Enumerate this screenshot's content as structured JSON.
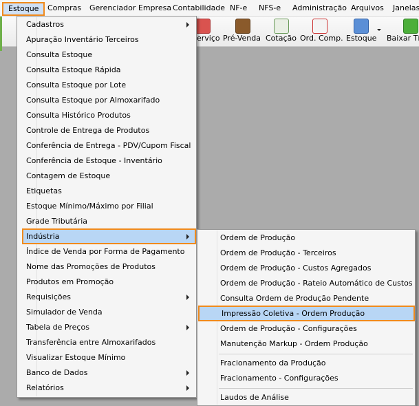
{
  "menubar": {
    "items": [
      "Estoque",
      "Compras",
      "Gerenciador Empresa",
      "Contabilidade",
      "NF-e",
      "NFS-e",
      "Administração",
      "Arquivos",
      "Janelas"
    ]
  },
  "toolbar": {
    "buttons": [
      {
        "label": "erviço",
        "icon": "service-icon"
      },
      {
        "label": "Pré-Venda",
        "icon": "pre-sale-icon"
      },
      {
        "label": "Cotação",
        "icon": "quotation-icon"
      },
      {
        "label": "Ord. Comp.",
        "icon": "purchase-order-icon"
      },
      {
        "label": "Estoque",
        "icon": "stock-icon"
      },
      {
        "label": "Baixar Títu",
        "icon": "check-icon"
      }
    ]
  },
  "estoque_menu": {
    "items": [
      {
        "label": "Cadastros",
        "submenu": true
      },
      {
        "label": "Apuração Inventário Terceiros"
      },
      {
        "label": "Consulta Estoque"
      },
      {
        "label": "Consulta Estoque Rápida"
      },
      {
        "label": "Consulta Estoque por Lote"
      },
      {
        "label": "Consulta Estoque por Almoxarifado"
      },
      {
        "label": "Consulta Histórico Produtos"
      },
      {
        "label": "Controle de Entrega de Produtos"
      },
      {
        "label": "Conferência de Entrega - PDV/Cupom Fiscal"
      },
      {
        "label": "Conferência de Estoque - Inventário"
      },
      {
        "label": "Contagem de Estoque"
      },
      {
        "label": "Etiquetas"
      },
      {
        "label": "Estoque Mínimo/Máximo por Filial"
      },
      {
        "label": "Grade Tributária"
      },
      {
        "label": "Indústria",
        "submenu": true,
        "highlighted": true
      },
      {
        "label": "Índice de Venda por Forma de Pagamento"
      },
      {
        "label": "Nome das Promoções de Produtos"
      },
      {
        "label": "Produtos em Promoção"
      },
      {
        "label": "Requisições",
        "submenu": true
      },
      {
        "label": "Simulador de Venda"
      },
      {
        "label": "Tabela de Preços",
        "submenu": true
      },
      {
        "label": "Transferência entre Almoxarifados"
      },
      {
        "label": "Visualizar Estoque Mínimo"
      },
      {
        "label": "Banco de Dados",
        "submenu": true
      },
      {
        "label": "Relatórios",
        "submenu": true
      }
    ]
  },
  "industria_submenu": {
    "items": [
      {
        "label": "Ordem de Produção"
      },
      {
        "label": "Ordem de Produção - Terceiros"
      },
      {
        "label": "Ordem de Produção - Custos Agregados"
      },
      {
        "label": "Ordem de Produção - Rateio Automático de Custos"
      },
      {
        "label": "Consulta Ordem de Produção Pendente"
      },
      {
        "label": "Impressão Coletiva - Ordem Produção",
        "highlighted": true
      },
      {
        "label": "Ordem de Produção - Configurações"
      },
      {
        "label": "Manutenção Markup - Ordem Produção"
      },
      {
        "label": "Fracionamento da Produção"
      },
      {
        "label": "Fracionamento - Configurações"
      },
      {
        "label": "Laudos de Análise"
      }
    ]
  },
  "colors": {
    "highlight_border": "#f08a1c",
    "highlight_fill": "#b8d6f5",
    "menu_bg": "#f5f5f5",
    "workspace_bg": "#ababab"
  }
}
